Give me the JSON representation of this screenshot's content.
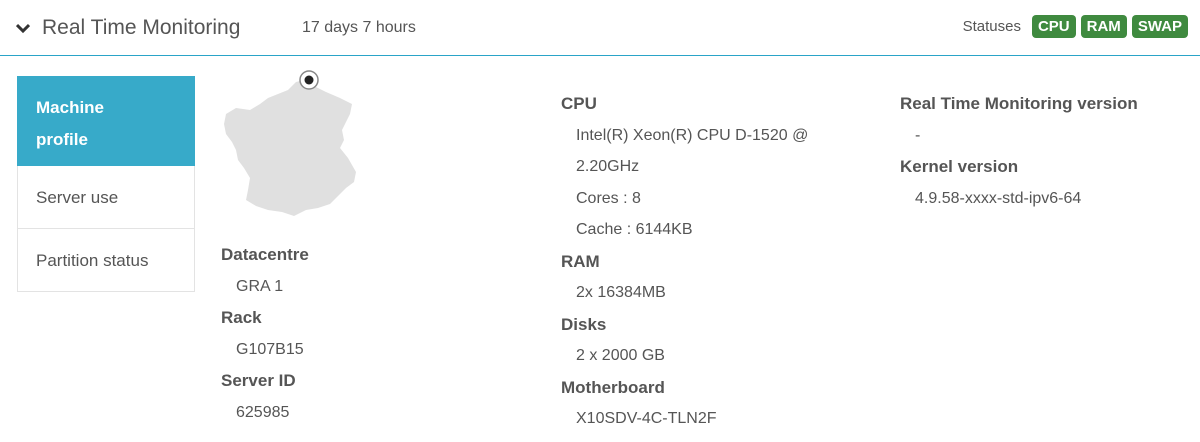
{
  "header": {
    "title": "Real Time Monitoring",
    "uptime": "17 days 7 hours",
    "statuses_label": "Statuses",
    "badges": [
      "CPU",
      "RAM",
      "SWAP"
    ]
  },
  "sidebar": {
    "items": [
      {
        "label_line1": "Machine",
        "label_line2": "profile",
        "active": true
      },
      {
        "label": "Server use",
        "active": false
      },
      {
        "label": "Partition status",
        "active": false
      }
    ]
  },
  "location": {
    "datacentre_label": "Datacentre",
    "datacentre": "GRA 1",
    "rack_label": "Rack",
    "rack": "G107B15",
    "server_id_label": "Server ID",
    "server_id": "625985"
  },
  "hardware": {
    "cpu_label": "CPU",
    "cpu_model_line1": "Intel(R) Xeon(R) CPU D-1520 @",
    "cpu_model_line2": "2.20GHz",
    "cores": "Cores : 8",
    "cache": "Cache : 6144KB",
    "ram_label": "RAM",
    "ram": "2x 16384MB",
    "disks_label": "Disks",
    "disks": "2 x 2000 GB",
    "motherboard_label": "Motherboard",
    "motherboard": "X10SDV-4C-TLN2F"
  },
  "software": {
    "rtm_version_label": "Real Time Monitoring version",
    "rtm_version": "-",
    "kernel_label": "Kernel version",
    "kernel": "4.9.58-xxxx-std-ipv6-64"
  },
  "colors": {
    "accent": "#37aac9",
    "badge_green": "#3f8a3f",
    "map_fill": "#e0e0e0"
  }
}
